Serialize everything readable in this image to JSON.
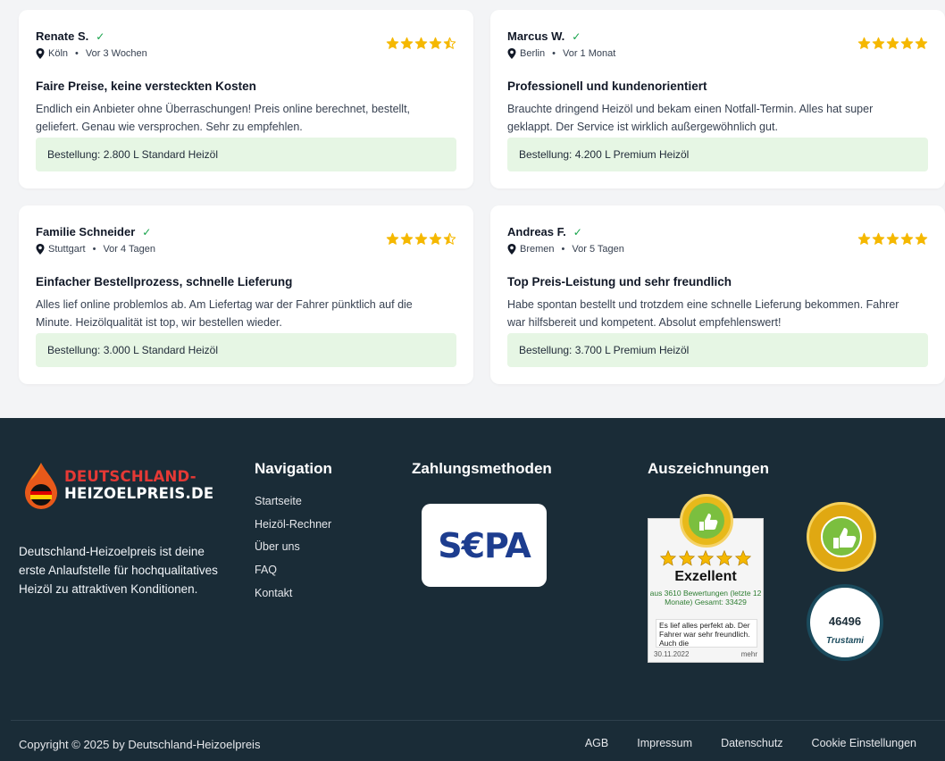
{
  "reviews": [
    {
      "name": "Renate S.",
      "city": "Köln",
      "time": "Vor 3 Wochen",
      "rating": 4.5,
      "title": "Faire Preise, keine versteckten Kosten",
      "text": "Endlich ein Anbieter ohne Überraschungen! Preis online berechnet, bestellt, geliefert. Genau wie versprochen. Sehr zu empfehlen.",
      "order": "Bestellung: 2.800 L Standard Heizöl"
    },
    {
      "name": "Marcus W.",
      "city": "Berlin",
      "time": "Vor 1 Monat",
      "rating": 5,
      "title": "Professionell und kundenorientiert",
      "text": "Brauchte dringend Heizöl und bekam einen Notfall-Termin. Alles hat super geklappt. Der Service ist wirklich außergewöhnlich gut.",
      "order": "Bestellung: 4.200 L Premium Heizöl"
    },
    {
      "name": "Familie Schneider",
      "city": "Stuttgart",
      "time": "Vor 4 Tagen",
      "rating": 4.5,
      "title": "Einfacher Bestellprozess, schnelle Lieferung",
      "text": "Alles lief online problemlos ab. Am Liefertag war der Fahrer pünktlich auf die Minute. Heizölqualität ist top, wir bestellen wieder.",
      "order": "Bestellung: 3.000 L Standard Heizöl"
    },
    {
      "name": "Andreas F.",
      "city": "Bremen",
      "time": "Vor 5 Tagen",
      "rating": 5,
      "title": "Top Preis-Leistung und sehr freundlich",
      "text": "Habe spontan bestellt und trotzdem eine schnelle Lieferung bekommen. Fahrer war hilfsbereit und kompetent. Absolut empfehlenswert!",
      "order": "Bestellung: 3.700 L Premium Heizöl"
    }
  ],
  "footer": {
    "logo_line1": "DEUTSCHLAND-",
    "logo_line2": "HEIZOELPREIS.DE",
    "about": "Deutschland-Heizoelpreis ist deine erste Anlaufstelle für hochqualitatives Heizöl zu attraktiven Konditionen.",
    "nav_title": "Navigation",
    "nav_items": [
      "Startseite",
      "Heizöl-Rechner",
      "Über uns",
      "FAQ",
      "Kontakt"
    ],
    "payment_title": "Zahlungsmethoden",
    "payment_sepa": "S€PA",
    "awards_title": "Auszeichnungen",
    "ekomi_label": "Exzellent",
    "ekomi_sub": "aus 3610 Bewertungen (letzte 12 Monate) Gesamt: 33429",
    "ekomi_quote": "Es lief alles perfekt ab. Der Fahrer war sehr freundlich. Auch die",
    "ekomi_date": "30.11.2022",
    "ekomi_more": "mehr",
    "trustami_num": "46496",
    "trustami_label": "Trustami",
    "copyright": "Copyright © 2025 by Deutschland-Heizoelpreis",
    "legal": [
      "AGB",
      "Impressum",
      "Datenschutz",
      "Cookie Einstellungen"
    ]
  },
  "colors": {
    "accent_green": "#16a34a",
    "star": "#f5b800",
    "footer_bg": "#1a2c37",
    "order_bg": "#e6f6e4"
  }
}
